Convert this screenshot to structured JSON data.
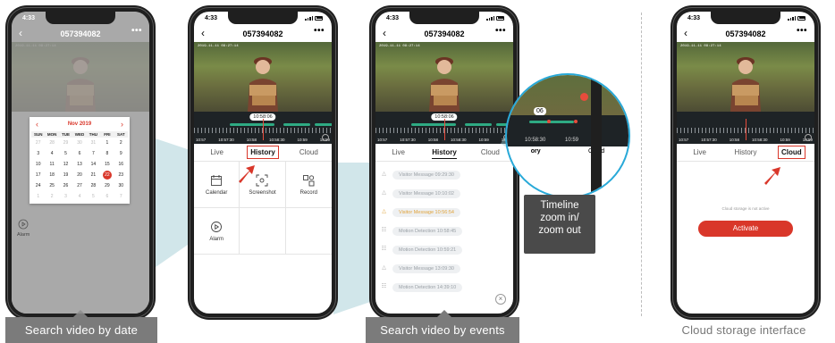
{
  "status_time": "4:33",
  "device_id": "057394082",
  "video_timestamp": "2019-11-11 09:27:14",
  "timeline": {
    "current_time": "10:58:06",
    "labels": [
      "10:57",
      "10:57:30",
      "10:58",
      "10:58:30",
      "10:59",
      "10:59"
    ]
  },
  "tabs": [
    "Live",
    "History",
    "Cloud"
  ],
  "phone1": {
    "calendar": {
      "month": "Nov 2019",
      "weekdays": [
        "SUN",
        "MON",
        "TUE",
        "WED",
        "THU",
        "FRI",
        "SAT"
      ],
      "weeks": [
        [
          "27",
          "28",
          "29",
          "30",
          "31",
          "1",
          "2"
        ],
        [
          "3",
          "4",
          "5",
          "6",
          "7",
          "8",
          "9"
        ],
        [
          "10",
          "11",
          "12",
          "13",
          "14",
          "15",
          "16"
        ],
        [
          "17",
          "18",
          "19",
          "20",
          "21",
          "22",
          "23"
        ],
        [
          "24",
          "25",
          "26",
          "27",
          "28",
          "29",
          "30"
        ],
        [
          "1",
          "2",
          "3",
          "4",
          "5",
          "6",
          "7"
        ]
      ],
      "selected_day": "22"
    },
    "alarm_label": "Alarm"
  },
  "phone2": {
    "cells": [
      {
        "label": "Calendar",
        "icon": "calendar-icon"
      },
      {
        "label": "Screenshot",
        "icon": "screenshot-icon"
      },
      {
        "label": "Record",
        "icon": "record-icon"
      },
      {
        "label": "Alarm",
        "icon": "alarm-icon"
      }
    ]
  },
  "phone3": {
    "events": [
      "Visitor Message 09:29:30",
      "Visitor Message 10:10:02",
      "Visitor Message 10:56:54",
      "Motion Detection 10:58:45",
      "Motion Detection 10:59:21",
      "Visitor Message 13:09:30",
      "Motion Detection 14:39:10"
    ],
    "highlighted_event_index": 2,
    "zoom_callout": "Timeline\nzoom in/\nzoom out",
    "zoom_labels": [
      "10:58:30",
      "10:59"
    ],
    "zoom_tabs": [
      "ory",
      "Cloud"
    ],
    "zoom_time": "06"
  },
  "phone4": {
    "cloud_message": "Cloud storage is not active",
    "activate_label": "Activate"
  },
  "captions": {
    "left": "Search video by date",
    "middle": "Search video by events",
    "right": "Cloud storage interface"
  },
  "colors": {
    "accent_red": "#d9372a",
    "timeline_green": "#2eaa83",
    "callout_blue": "#28a9d8"
  }
}
